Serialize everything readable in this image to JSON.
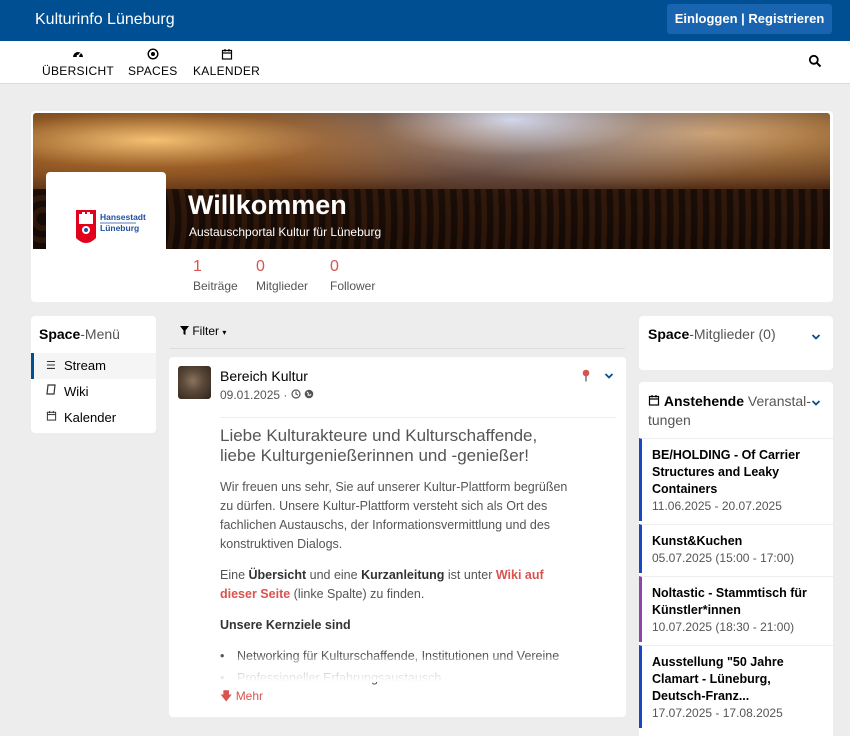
{
  "topbar": {
    "brand": "Kulturinfo Lüneburg",
    "login_label": "Einloggen | Registrieren"
  },
  "nav": [
    {
      "label": "ÜBERSICHT",
      "icon": "dashboard-icon"
    },
    {
      "label": "SPACES",
      "icon": "dot-circle-icon"
    },
    {
      "label": "KALENDER",
      "icon": "calendar-icon"
    }
  ],
  "header": {
    "title": "Willkommen",
    "subtitle": "Austauschportal Kultur für Lüneburg",
    "logo_text_line1": "Hansestadt",
    "logo_text_line2": "Lüneburg",
    "stats": [
      {
        "value": "1",
        "label": "Beiträge"
      },
      {
        "value": "0",
        "label": "Mitglieder"
      },
      {
        "value": "0",
        "label": "Follower"
      }
    ]
  },
  "space_menu": {
    "title_bold": "Space",
    "title_rest": "-Menü",
    "items": [
      {
        "label": "Stream",
        "icon": "bars-icon",
        "active": true
      },
      {
        "label": "Wiki",
        "icon": "book-icon",
        "active": false
      },
      {
        "label": "Kalender",
        "icon": "calendar-icon",
        "active": false
      }
    ]
  },
  "filter_label": "Filter",
  "post": {
    "author": "Bereich Kultur",
    "date": "09.01.2025 ·",
    "headline": "Liebe Kulturakteure und Kulturschaffende, liebe Kulturgenießerinnen und -genießer!",
    "para1": "Wir freuen uns sehr, Sie auf unserer Kultur-Plattform begrüßen zu dürfen. Unsere Kultur-Plattform versteht sich als Ort des fachlichen Austauschs, der Informationsvermittlung und des konstruktiven Dialogs.",
    "para2_a": "Eine ",
    "para2_b": "Übersicht",
    "para2_c": " und eine ",
    "para2_d": "Kurzanleitung",
    "para2_e": " ist unter ",
    "para2_link": "Wiki auf dieser Seite",
    "para2_f": " (linke Spalte) zu finden.",
    "goals_title": "Unsere Kernziele sind",
    "bullets": [
      "Networking für Kulturschaffende, Institutionen und Vereine",
      "Professioneller Erfahrungsaustausch"
    ],
    "more_label": "Mehr"
  },
  "members_panel": {
    "title_bold": "Space",
    "title_rest": "-Mitglieder (0)"
  },
  "events_panel": {
    "title_bold": "Anstehende",
    "title_rest_1": " Veranstal-",
    "title_rest_2": "tungen",
    "events": [
      {
        "name": "BE/HOLDING - Of Carrier Structures and Leaky Containers",
        "date": "11.06.2025 - 20.07.2025",
        "color": "#1a47c8"
      },
      {
        "name": "Kunst&Kuchen",
        "date": "05.07.2025 (15:00 - 17:00)",
        "color": "#1a47c8"
      },
      {
        "name": "Noltastic - Stammtisch für Künstler*innen",
        "date": "10.07.2025 (18:30 - 21:00)",
        "color": "#8e44ad"
      },
      {
        "name": "Ausstellung \"50 Jahre Clamart - Lüneburg, Deutsch-Franz...",
        "date": "17.07.2025 - 17.08.2025",
        "color": "#1a47c8"
      }
    ]
  }
}
